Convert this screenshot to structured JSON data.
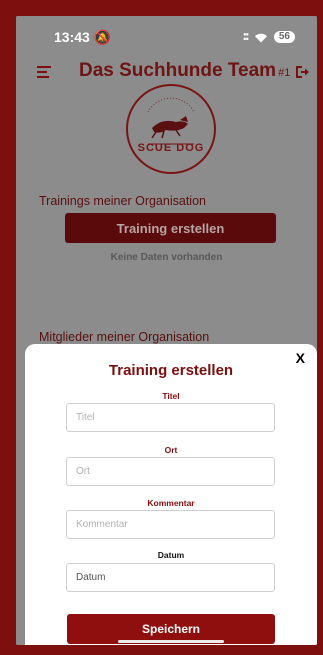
{
  "status_bar": {
    "time": "13:43",
    "battery": "56"
  },
  "app_bar": {
    "title": "Das Suchhunde Team",
    "suffix": "#1"
  },
  "logo": {
    "text": "SCUE DOG"
  },
  "trainings_section": {
    "title": "Trainings meiner Organisation",
    "create_button_label": "Training erstellen",
    "empty_text": "Keine Daten vorhanden"
  },
  "members_section": {
    "title": "Mitglieder meiner Organisation"
  },
  "modal": {
    "title": "Training erstellen",
    "close_label": "X",
    "fields": [
      {
        "label": "Titel",
        "placeholder": "Titel",
        "label_color": "#8a0e0e"
      },
      {
        "label": "Ort",
        "placeholder": "Ort",
        "label_color": "#7a0f0f"
      },
      {
        "label": "Kommentar",
        "placeholder": "Kommentar",
        "label_color": "#8a0e0e"
      },
      {
        "label": "Datum",
        "placeholder": "Datum",
        "label_color": "#111111"
      }
    ],
    "save_button_label": "Speichern"
  },
  "colors": {
    "brand": "#8f0e0e",
    "frame": "#7d0f0f",
    "overlay": "#8c8c8c"
  }
}
